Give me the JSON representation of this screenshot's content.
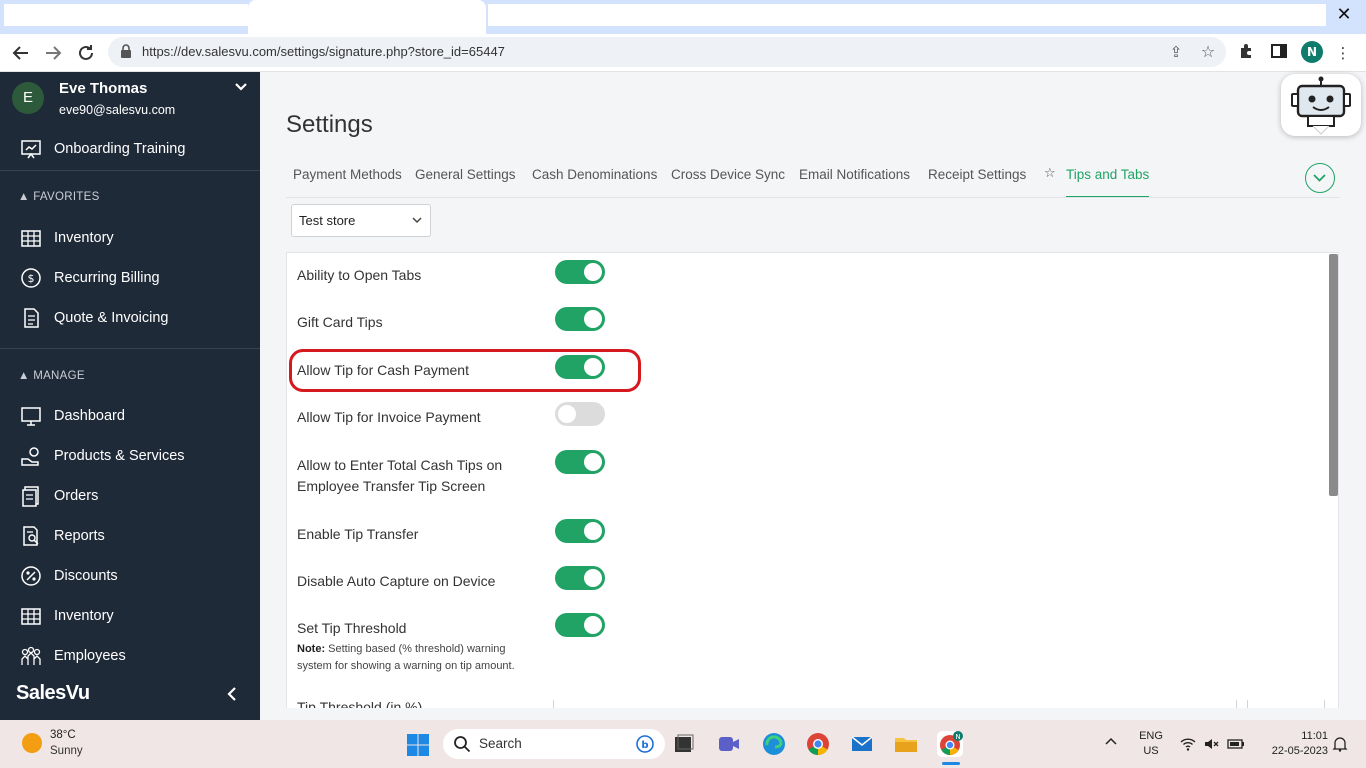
{
  "browser": {
    "url": "https://dev.salesvu.com/settings/signature.php?store_id=65447",
    "profile_initial": "N",
    "close_glyph": "✕"
  },
  "sidebar": {
    "user": {
      "initial": "E",
      "name": "Eve Thomas",
      "email": "eve90@salesvu.com"
    },
    "top_items": [
      {
        "label": "Onboarding Training",
        "icon": "training-icon"
      }
    ],
    "favorites_title": "FAVORITES",
    "favorites": [
      {
        "label": "Inventory",
        "icon": "inventory-icon"
      },
      {
        "label": "Recurring Billing",
        "icon": "dollar-circle-icon"
      },
      {
        "label": "Quote & Invoicing",
        "icon": "document-icon"
      }
    ],
    "manage_title": "MANAGE",
    "manage": [
      {
        "label": "Dashboard",
        "icon": "monitor-icon"
      },
      {
        "label": "Products & Services",
        "icon": "products-icon"
      },
      {
        "label": "Orders",
        "icon": "orders-icon"
      },
      {
        "label": "Reports",
        "icon": "reports-icon"
      },
      {
        "label": "Discounts",
        "icon": "percent-icon"
      },
      {
        "label": "Inventory",
        "icon": "inventory-icon"
      },
      {
        "label": "Employees",
        "icon": "employees-icon"
      }
    ],
    "brand": "SalesVu"
  },
  "page": {
    "title": "Settings",
    "tabs": [
      {
        "label": "Payment Methods",
        "active": false
      },
      {
        "label": "General Settings",
        "active": false
      },
      {
        "label": "Cash Denominations",
        "active": false
      },
      {
        "label": "Cross Device Sync",
        "active": false
      },
      {
        "label": "Email Notifications",
        "active": false
      },
      {
        "label": "Receipt Settings",
        "active": false
      },
      {
        "label": "Tips and Tabs",
        "active": true
      }
    ],
    "store_select": "Test store",
    "settings": [
      {
        "label": "Ability to Open Tabs",
        "on": true
      },
      {
        "label": "Gift Card Tips",
        "on": true
      },
      {
        "label": "Allow Tip for Cash Payment",
        "on": true
      },
      {
        "label": "Allow Tip for Invoice Payment",
        "on": false
      },
      {
        "label": "Allow to Enter Total Cash Tips on Employee Transfer Tip Screen",
        "on": true
      },
      {
        "label": "Enable Tip Transfer",
        "on": true
      },
      {
        "label": "Disable Auto Capture on Device",
        "on": true
      },
      {
        "label": "Set Tip Threshold",
        "on": true
      }
    ],
    "note_label": "Note:",
    "note_text": "Setting based (% threshold) warning system for showing a warning on tip amount.",
    "threshold_label": "Tip Threshold (in %)"
  },
  "taskbar": {
    "weather_temp": "38°C",
    "weather_desc": "Sunny",
    "search_label": "Search",
    "lang_line1": "ENG",
    "lang_line2": "US",
    "time": "11:01",
    "date": "22-05-2023"
  },
  "colors": {
    "accent": "#21a366",
    "sidebar": "#1f2a38",
    "highlight": "#d6181f"
  }
}
